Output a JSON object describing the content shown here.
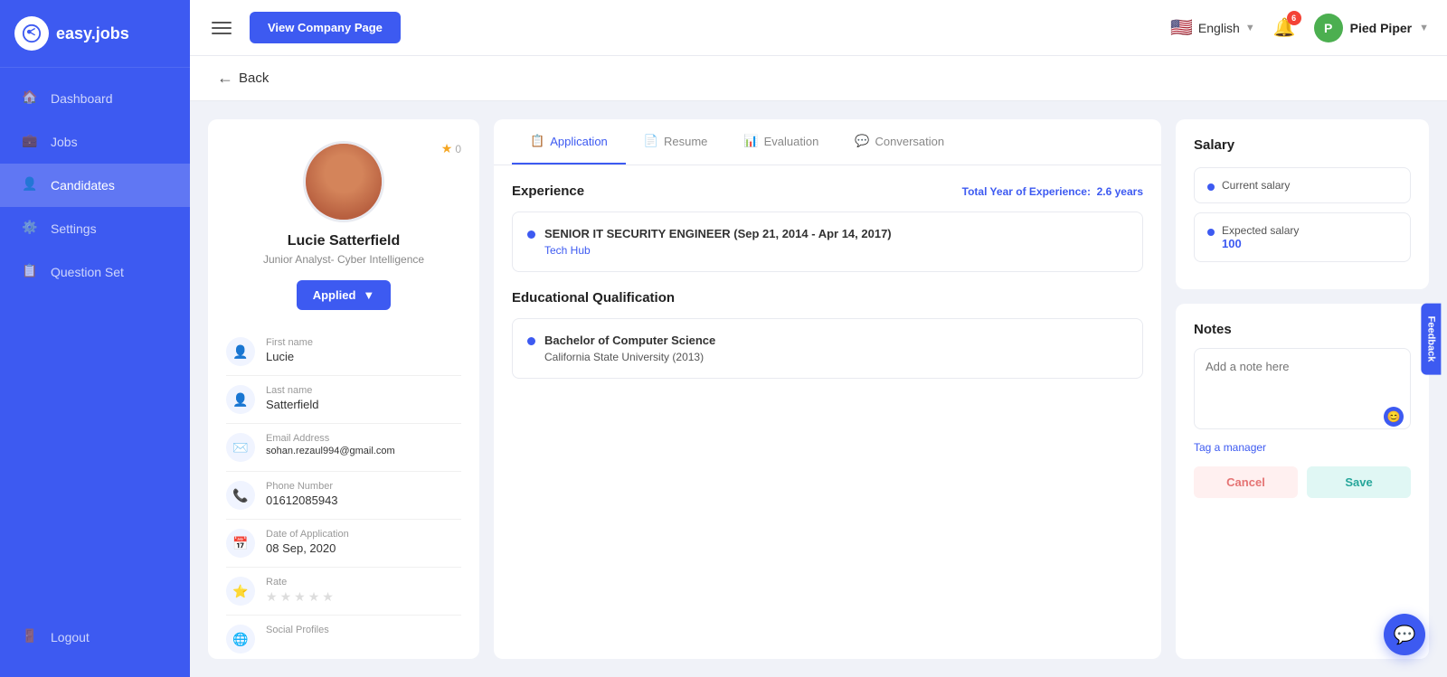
{
  "sidebar": {
    "logo_text": "easy.jobs",
    "nav_items": [
      {
        "id": "dashboard",
        "label": "Dashboard",
        "icon": "home"
      },
      {
        "id": "jobs",
        "label": "Jobs",
        "icon": "briefcase"
      },
      {
        "id": "candidates",
        "label": "Candidates",
        "icon": "person",
        "active": true
      },
      {
        "id": "settings",
        "label": "Settings",
        "icon": "gear"
      },
      {
        "id": "question-set",
        "label": "Question Set",
        "icon": "clipboard"
      }
    ],
    "logout_label": "Logout"
  },
  "header": {
    "menu_icon": "hamburger",
    "view_company_btn": "View Company Page",
    "language": "English",
    "notification_count": "6",
    "company_name": "Pied Piper",
    "company_initial": "P"
  },
  "back_label": "Back",
  "candidate": {
    "name": "Lucie Satterfield",
    "title": "Junior Analyst- Cyber Intelligence",
    "status": "Applied",
    "star_count": "0",
    "first_name_label": "First name",
    "first_name": "Lucie",
    "last_name_label": "Last name",
    "last_name": "Satterfield",
    "email_label": "Email Address",
    "email": "sohan.rezaul994@gmail.com",
    "phone_label": "Phone Number",
    "phone": "01612085943",
    "doa_label": "Date of Application",
    "doa": "08 Sep, 2020",
    "rate_label": "Rate",
    "social_label": "Social Profiles"
  },
  "tabs": [
    {
      "id": "application",
      "label": "Application",
      "icon": "📋",
      "active": true
    },
    {
      "id": "resume",
      "label": "Resume",
      "icon": "📄"
    },
    {
      "id": "evaluation",
      "label": "Evaluation",
      "icon": "📊"
    },
    {
      "id": "conversation",
      "label": "Conversation",
      "icon": "💬"
    }
  ],
  "experience": {
    "section_title": "Experience",
    "total_years_label": "Total Year of Experience:",
    "total_years_value": "2.6 years",
    "items": [
      {
        "job_title": "SENIOR IT SECURITY ENGINEER (Sep 21, 2014 - Apr 14, 2017)",
        "company": "Tech Hub"
      }
    ]
  },
  "education": {
    "section_title": "Educational Qualification",
    "items": [
      {
        "degree": "Bachelor of Computer Science",
        "school": "California State University",
        "year": "(2013)"
      }
    ]
  },
  "salary": {
    "title": "Salary",
    "current_label": "Current salary",
    "current_value": "",
    "expected_label": "Expected salary",
    "expected_value": "100"
  },
  "notes": {
    "title": "Notes",
    "placeholder": "Add a note here",
    "tag_manager": "Tag a manager",
    "cancel_label": "Cancel",
    "save_label": "Save"
  },
  "feedback_tab": "Feedback"
}
